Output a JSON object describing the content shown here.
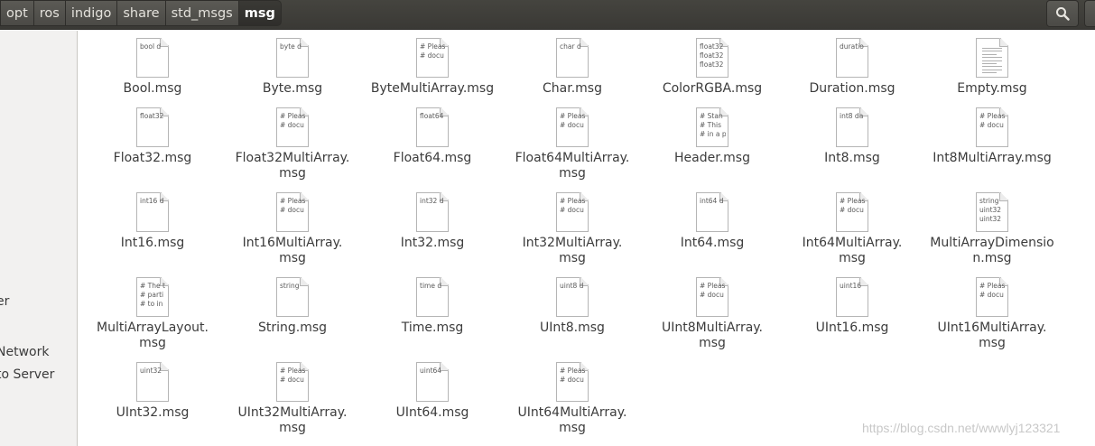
{
  "breadcrumb": [
    "opt",
    "ros",
    "indigo",
    "share",
    "std_msgs",
    "msg"
  ],
  "icons": {
    "search": "search-icon"
  },
  "sidebar": {
    "items": [
      {
        "label": "er"
      },
      {
        "label": "Network"
      },
      {
        "label": "to Server"
      }
    ]
  },
  "files": [
    {
      "name": "Bool.msg",
      "preview": "bool d"
    },
    {
      "name": "Byte.msg",
      "preview": "byte d"
    },
    {
      "name": "ByteMultiArray.msg",
      "preview": "# Pleas\n# docu"
    },
    {
      "name": "Char.msg",
      "preview": "char d"
    },
    {
      "name": "ColorRGBA.msg",
      "preview": "float32\nfloat32\nfloat32"
    },
    {
      "name": "Duration.msg",
      "preview": "duratio"
    },
    {
      "name": "Empty.msg",
      "preview": ""
    },
    {
      "name": "Float32.msg",
      "preview": "float32"
    },
    {
      "name": "Float32MultiArray.\nmsg",
      "preview": "# Pleas\n# docu"
    },
    {
      "name": "Float64.msg",
      "preview": "float64"
    },
    {
      "name": "Float64MultiArray.\nmsg",
      "preview": "# Pleas\n# docu"
    },
    {
      "name": "Header.msg",
      "preview": "# Stan\n# This\n# in a p"
    },
    {
      "name": "Int8.msg",
      "preview": "int8 da"
    },
    {
      "name": "Int8MultiArray.msg",
      "preview": "# Pleas\n# docu"
    },
    {
      "name": "Int16.msg",
      "preview": "int16 d"
    },
    {
      "name": "Int16MultiArray.\nmsg",
      "preview": "# Pleas\n# docu"
    },
    {
      "name": "Int32.msg",
      "preview": "int32 d"
    },
    {
      "name": "Int32MultiArray.\nmsg",
      "preview": "# Pleas\n# docu"
    },
    {
      "name": "Int64.msg",
      "preview": "int64 d"
    },
    {
      "name": "Int64MultiArray.\nmsg",
      "preview": "# Pleas\n# docu"
    },
    {
      "name": "MultiArrayDimensio\nn.msg",
      "preview": "string\nuint32\nuint32"
    },
    {
      "name": "MultiArrayLayout.\nmsg",
      "preview": "# The t\n# parti\n# to in"
    },
    {
      "name": "String.msg",
      "preview": "string"
    },
    {
      "name": "Time.msg",
      "preview": "time d"
    },
    {
      "name": "UInt8.msg",
      "preview": "uint8 d"
    },
    {
      "name": "UInt8MultiArray.\nmsg",
      "preview": "# Pleas\n# docu"
    },
    {
      "name": "UInt16.msg",
      "preview": "uint16"
    },
    {
      "name": "UInt16MultiArray.\nmsg",
      "preview": "# Pleas\n# docu"
    },
    {
      "name": "UInt32.msg",
      "preview": "uint32"
    },
    {
      "name": "UInt32MultiArray.\nmsg",
      "preview": "# Pleas\n# docu"
    },
    {
      "name": "UInt64.msg",
      "preview": "uint64"
    },
    {
      "name": "UInt64MultiArray.\nmsg",
      "preview": "# Pleas\n# docu"
    }
  ],
  "watermark": "https://blog.csdn.net/wwwlyj123321"
}
